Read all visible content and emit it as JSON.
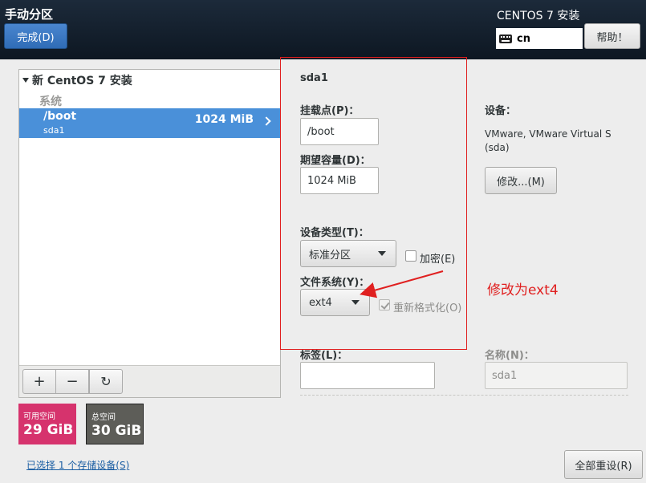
{
  "header": {
    "title": "手动分区",
    "done_label": "完成(D)",
    "product": "CENTOS 7 安装",
    "keyboard_layout": "cn",
    "help_label": "帮助！"
  },
  "partitions": {
    "install_title": "新 CentOS 7 安装",
    "group_label": "系统",
    "selected": {
      "mount": "/boot",
      "device": "sda1",
      "size": "1024 MiB"
    },
    "toolbar": {
      "add": "+",
      "remove": "−",
      "refresh": "↻"
    }
  },
  "space": {
    "available_label": "可用空间",
    "available_value": "29 GiB",
    "total_label": "总空间",
    "total_value": "30 GiB"
  },
  "storage_link": "已选择 1 个存储设备(S)",
  "detail": {
    "title": "sda1",
    "mount_point_label": "挂载点(P)：",
    "mount_point_value": "/boot",
    "desired_capacity_label": "期望容量(D)：",
    "desired_capacity_value": "1024 MiB",
    "device_label": "设备：",
    "device_value_line1": "VMware, VMware Virtual S",
    "device_value_line2": "(sda)",
    "modify_label": "修改...(M)",
    "device_type_label": "设备类型(T)：",
    "device_type_value": "标准分区",
    "encrypt_label": "加密(E)",
    "filesystem_label": "文件系统(Y)：",
    "filesystem_value": "ext4",
    "reformat_label": "重新格式化(O)",
    "tag_label": "标签(L)：",
    "tag_value": "",
    "name_label": "名称(N)：",
    "name_value": "sda1",
    "reset_all_label": "全部重设(R)"
  },
  "annotation": "修改为ext4",
  "colors": {
    "header_bg": "#1c2a3a",
    "selected_row": "#4a90d9",
    "available_space": "#d6336d",
    "total_space": "#5d5d58",
    "annotation": "#e02020"
  }
}
